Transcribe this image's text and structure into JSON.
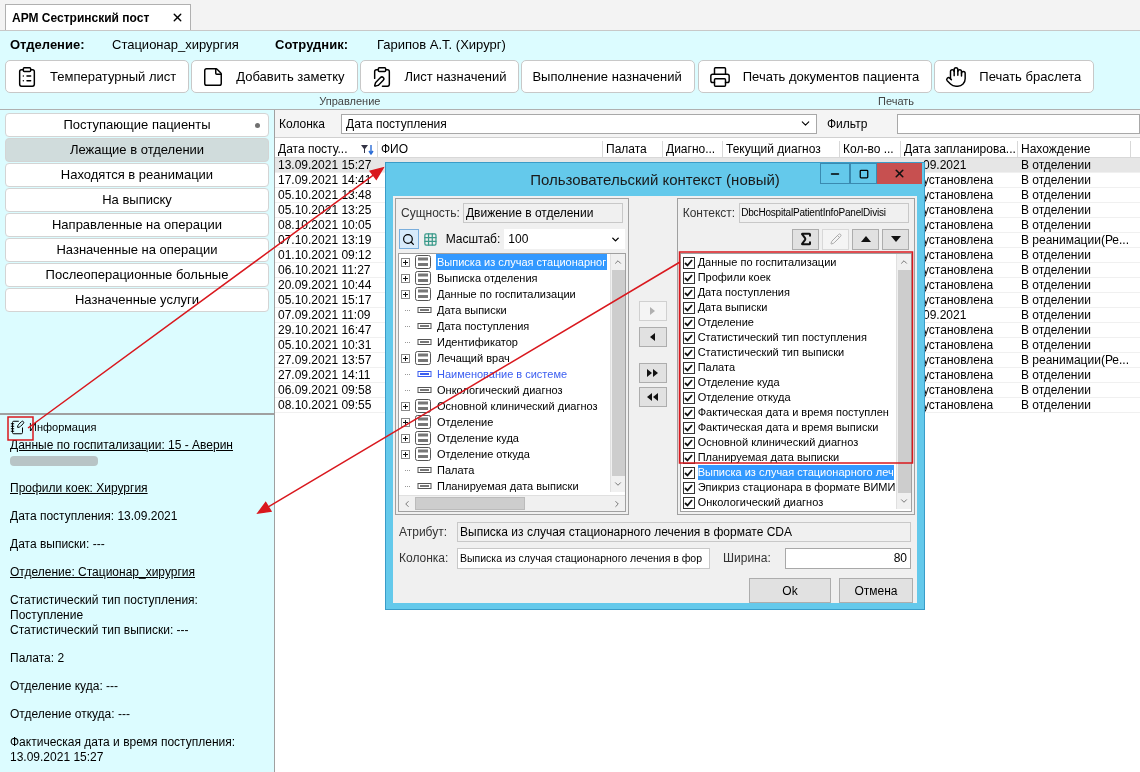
{
  "tab": {
    "label": "АРМ Сестринский пост"
  },
  "header": [
    {
      "label": "Отделение:",
      "value": "Стационар_хирургия"
    },
    {
      "label": "Сотрудник:",
      "value": "Гарипов А.Т. (Хирург)"
    }
  ],
  "toolbar_groups": [
    {
      "label": "Управление",
      "buttons": [
        "Температурный лист",
        "Добавить заметку",
        "Лист назначений",
        "Выполнение назначений"
      ]
    },
    {
      "label": "Печать",
      "buttons": [
        "Печать документов пациента",
        "Печать браслета"
      ]
    }
  ],
  "nav": [
    {
      "label": "Поступающие пациенты",
      "selected": false,
      "marked": true
    },
    {
      "label": "Лежащие в отделении",
      "selected": true,
      "marked": false
    },
    {
      "label": "Находятся в реанимации",
      "selected": false,
      "marked": false
    },
    {
      "label": "На выписку",
      "selected": false,
      "marked": false
    },
    {
      "label": "Направленные на операции",
      "selected": false,
      "marked": false
    },
    {
      "label": "Назначенные на операции",
      "selected": false,
      "marked": false
    },
    {
      "label": "Послеоперационные больные",
      "selected": false,
      "marked": false
    },
    {
      "label": "Назначенные услуги",
      "selected": false,
      "marked": false
    }
  ],
  "info": {
    "title": "Информация",
    "sections": [
      [
        {
          "text": "Данные по госпитализации: 15 - Аверин",
          "link": true,
          "redacted": true
        }
      ],
      [
        {
          "text": "Профили коек: Хирургия",
          "link": true,
          "redacted": false
        }
      ],
      [
        {
          "text": "Дата поступления: 13.09.2021",
          "link": false,
          "redacted": false
        }
      ],
      [
        {
          "text": "Дата выписки: ---",
          "link": false,
          "redacted": false
        }
      ],
      [
        {
          "text": "Отделение: Стационар_хирургия",
          "link": true,
          "redacted": false
        }
      ],
      [
        {
          "text": "Статистический тип поступления: Поступление",
          "link": false,
          "redacted": false
        },
        {
          "text": "Статистический тип выписки: ---",
          "link": false,
          "redacted": false
        }
      ],
      [
        {
          "text": "Палата: 2",
          "link": false,
          "redacted": false
        }
      ],
      [
        {
          "text": "Отделение куда: ---",
          "link": false,
          "redacted": false
        }
      ],
      [
        {
          "text": "Отделение откуда: ---",
          "link": false,
          "redacted": false
        }
      ],
      [
        {
          "text": "Фактическая дата и время поступления: 13.09.2021 15:27",
          "link": false,
          "redacted": false
        }
      ]
    ]
  },
  "filter": {
    "column_label": "Колонка",
    "column_value": "Дата поступления",
    "filter_label": "Фильтр"
  },
  "table": {
    "columns": [
      "Дата посту...",
      "ФИО",
      "Палата",
      "Диагно...",
      "Текущий диагноз",
      "Кол-во ...",
      "Дата запланирова...",
      "Нахождение"
    ],
    "rows": [
      {
        "selected": true,
        "admitted": "13.09.2021 15:27",
        "planned": "09.2021",
        "location": "В отделении"
      },
      {
        "selected": false,
        "admitted": "17.09.2021 14:41",
        "planned": "установлена",
        "location": "В отделении"
      },
      {
        "selected": false,
        "admitted": "05.10.2021 13:48",
        "planned": "установлена",
        "location": "В отделении"
      },
      {
        "selected": false,
        "admitted": "05.10.2021 13:25",
        "planned": "установлена",
        "location": "В отделении"
      },
      {
        "selected": false,
        "admitted": "08.10.2021 10:05",
        "planned": "установлена",
        "location": "В отделении"
      },
      {
        "selected": false,
        "admitted": "07.10.2021 13:19",
        "planned": "установлена",
        "location": "В реанимации(Ре..."
      },
      {
        "selected": false,
        "admitted": "01.10.2021 09:12",
        "planned": "установлена",
        "location": "В отделении"
      },
      {
        "selected": false,
        "admitted": "06.10.2021 11:27",
        "planned": "установлена",
        "location": "В отделении"
      },
      {
        "selected": false,
        "admitted": "20.09.2021 10:44",
        "planned": "установлена",
        "location": "В отделении"
      },
      {
        "selected": false,
        "admitted": "05.10.2021 15:17",
        "planned": "установлена",
        "location": "В отделении"
      },
      {
        "selected": false,
        "admitted": "07.09.2021 11:09",
        "planned": "09.2021",
        "location": "В отделении"
      },
      {
        "selected": false,
        "admitted": "29.10.2021 16:47",
        "planned": "установлена",
        "location": "В отделении"
      },
      {
        "selected": false,
        "admitted": "05.10.2021 10:31",
        "planned": "установлена",
        "location": "В отделении"
      },
      {
        "selected": false,
        "admitted": "27.09.2021 13:57",
        "planned": "установлена",
        "location": "В реанимации(Ре..."
      },
      {
        "selected": false,
        "admitted": "27.09.2021 14:11",
        "planned": "установлена",
        "location": "В отделении"
      },
      {
        "selected": false,
        "admitted": "06.09.2021 09:58",
        "planned": "установлена",
        "location": "В отделении"
      },
      {
        "selected": false,
        "admitted": "08.10.2021 09:55",
        "planned": "установлена",
        "location": "В отделении"
      }
    ]
  },
  "dialog": {
    "title": "Пользовательский контекст (новый)",
    "entity_label": "Сущность:",
    "entity_value": "Движение в отделении",
    "scale_label": "Масштаб:",
    "scale_value": "100",
    "tree": [
      {
        "label": "Выписка из случая стационарног",
        "kind": "group",
        "selected": true,
        "accent": false
      },
      {
        "label": "Выписка отделения",
        "kind": "group",
        "selected": false,
        "accent": false
      },
      {
        "label": "Данные по госпитализации",
        "kind": "group",
        "selected": false,
        "accent": false
      },
      {
        "label": "Дата выписки",
        "kind": "field",
        "selected": false,
        "accent": false
      },
      {
        "label": "Дата поступления",
        "kind": "field",
        "selected": false,
        "accent": false
      },
      {
        "label": "Идентификатор",
        "kind": "field",
        "selected": false,
        "accent": false
      },
      {
        "label": "Лечащий врач",
        "kind": "group",
        "selected": false,
        "accent": false
      },
      {
        "label": "Наименование в системе",
        "kind": "field",
        "selected": false,
        "accent": true
      },
      {
        "label": "Онкологический диагноз",
        "kind": "field",
        "selected": false,
        "accent": false
      },
      {
        "label": "Основной клинический диагноз",
        "kind": "group",
        "selected": false,
        "accent": false
      },
      {
        "label": "Отделение",
        "kind": "group",
        "selected": false,
        "accent": false
      },
      {
        "label": "Отделение куда",
        "kind": "group",
        "selected": false,
        "accent": false
      },
      {
        "label": "Отделение откуда",
        "kind": "group",
        "selected": false,
        "accent": false
      },
      {
        "label": "Палата",
        "kind": "field",
        "selected": false,
        "accent": false
      },
      {
        "label": "Планируемая дата выписки",
        "kind": "field",
        "selected": false,
        "accent": false
      }
    ],
    "move_buttons": [
      {
        "disabled": true
      },
      {
        "disabled": false
      },
      {
        "disabled": false
      },
      {
        "disabled": false
      }
    ],
    "context_label": "Контекст:",
    "context_value": "DbcHospitalPatientInfoPanelDivisi",
    "tools": [
      {
        "disabled": false
      },
      {
        "disabled": true
      },
      {
        "disabled": false
      },
      {
        "disabled": false
      }
    ],
    "columns": [
      {
        "label": "Данные по госпитализации",
        "checked": true,
        "selected": false
      },
      {
        "label": "Профили коек",
        "checked": true,
        "selected": false
      },
      {
        "label": "Дата поступления",
        "checked": true,
        "selected": false
      },
      {
        "label": "Дата выписки",
        "checked": true,
        "selected": false
      },
      {
        "label": "Отделение",
        "checked": true,
        "selected": false
      },
      {
        "label": "Статистический тип поступления",
        "checked": true,
        "selected": false
      },
      {
        "label": "Статистический тип выписки",
        "checked": true,
        "selected": false
      },
      {
        "label": "Палата",
        "checked": true,
        "selected": false
      },
      {
        "label": "Отделение куда",
        "checked": true,
        "selected": false
      },
      {
        "label": "Отделение откуда",
        "checked": true,
        "selected": false
      },
      {
        "label": "Фактическая дата и время поступлен",
        "checked": true,
        "selected": false
      },
      {
        "label": "Фактическая дата и время выписки",
        "checked": true,
        "selected": false
      },
      {
        "label": "Основной клинический диагноз",
        "checked": true,
        "selected": false
      },
      {
        "label": "Планируемая дата выписки",
        "checked": true,
        "selected": false
      },
      {
        "label": "Выписка из случая стационарного леч",
        "checked": true,
        "selected": true
      },
      {
        "label": "Эпикриз стационара в формате ВИМИ",
        "checked": true,
        "selected": false
      },
      {
        "label": "Онкологический диагноз",
        "checked": true,
        "selected": false
      }
    ],
    "attribute_label": "Атрибут:",
    "attribute_value": "Выписка из случая стационарного лечения в формате CDA",
    "column_label": "Колонка:",
    "column_value": "Выписка из случая стационарного лечения в фор",
    "width_label": "Ширина:",
    "width_value": "80",
    "buttons": [
      "Ok",
      "Отмена"
    ]
  }
}
